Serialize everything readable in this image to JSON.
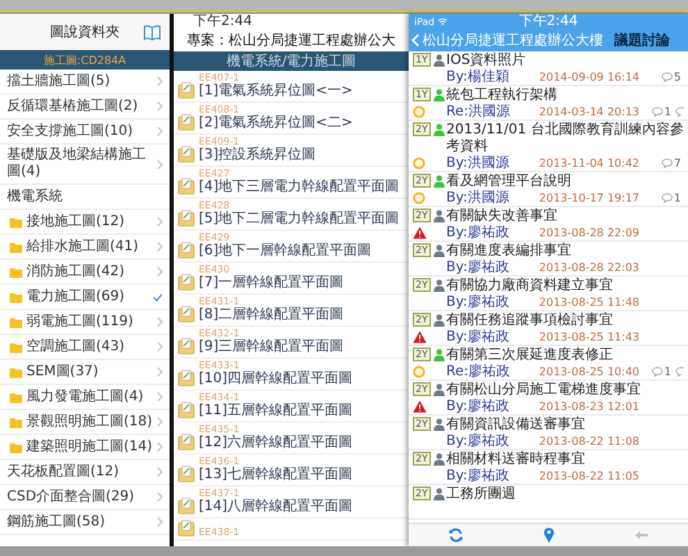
{
  "folder_panel": {
    "title": "圖說資料夾",
    "section": "施工圖:CD284A",
    "items": [
      {
        "label": "擋土牆施工圖(5)",
        "selected": false
      },
      {
        "label": "反循環基樁施工圖(2)",
        "selected": false
      },
      {
        "label": "安全支撐施工圖(10)",
        "selected": false
      },
      {
        "label": "基礎版及地梁結構施工圖(4)",
        "selected": false
      },
      {
        "label": "機電系統",
        "selected": false,
        "children": [
          {
            "label": "接地施工圖(12)",
            "selected": false
          },
          {
            "label": "給排水施工圖(41)",
            "selected": false
          },
          {
            "label": "消防施工圖(42)",
            "selected": false
          },
          {
            "label": "電力施工圖(69)",
            "selected": true
          },
          {
            "label": "弱電施工圖(119)",
            "selected": false
          },
          {
            "label": "空調施工圖(43)",
            "selected": false
          },
          {
            "label": "SEM圖(37)",
            "selected": false
          },
          {
            "label": "風力發電施工圖(4)",
            "selected": false
          },
          {
            "label": "景觀照明施工圖(18)",
            "selected": false
          },
          {
            "label": "建築照明施工圖(14)",
            "selected": false
          }
        ]
      },
      {
        "label": "天花板配置圖(12)",
        "selected": false
      },
      {
        "label": "CSD介面整合圖(29)",
        "selected": false
      },
      {
        "label": "鋼筋施工圖(58)",
        "selected": false
      }
    ]
  },
  "drawing_panel": {
    "status_time": "下午2:44",
    "title": "專案：松山分局捷運工程處辦公大",
    "path": "機電系統/電力施工圖",
    "items": [
      {
        "code": "EE407-1",
        "title": "[1]電氣系統昇位圖<一>"
      },
      {
        "code": "EE408-1",
        "title": "[2]電氣系統昇位圖<二>"
      },
      {
        "code": "EE409-1",
        "title": "[3]控設系統昇位圖"
      },
      {
        "code": "EE427",
        "title": "[4]地下三層電力幹線配置平面圖"
      },
      {
        "code": "EE428",
        "title": "[5]地下二層電力幹線配置平面圖"
      },
      {
        "code": "EE429",
        "title": "[6]地下一層幹線配置平面圖"
      },
      {
        "code": "EE430",
        "title": "[7]一層幹線配置平面圖"
      },
      {
        "code": "EE431-1",
        "title": "[8]二層幹線配置平面圖"
      },
      {
        "code": "EE432-1",
        "title": "[9]三層幹線配置平面圖"
      },
      {
        "code": "EE433-1",
        "title": "[10]四層幹線配置平面圖"
      },
      {
        "code": "EE434-1",
        "title": "[11]五層幹線配置平面圖"
      },
      {
        "code": "EE435-1",
        "title": "[12]六層幹線配置平面圖"
      },
      {
        "code": "EE436-1",
        "title": "[13]七層幹線配置平面圖"
      },
      {
        "code": "EE437-1",
        "title": "[14]八層幹線配置平面圖"
      },
      {
        "code": "EE438-1"
      }
    ]
  },
  "topic_panel": {
    "status_carrier": "iPad",
    "status_time": "下午2:44",
    "back_label": "松山分局捷運工程處辦公大樓",
    "title": "議題討論",
    "topics": [
      {
        "age": "1Y",
        "online": false,
        "kind": "plain",
        "title": "IOS資料照片",
        "author": "By:楊佳穎",
        "date": "2014-09-09 16:14",
        "replies": "5"
      },
      {
        "age": "1Y",
        "online": true,
        "kind": "circle",
        "title": "統包工程執行架構",
        "author": "Re:洪國源",
        "date": "2014-03-14 20:13",
        "replies": "1",
        "second_bubble": true
      },
      {
        "age": "2Y",
        "online": true,
        "kind": "circle",
        "title": "2013/11/01 台北國際教育訓練內容參考資料",
        "author": "By:洪國源",
        "date": "2013-11-04 10:42",
        "replies": "7"
      },
      {
        "age": "2Y",
        "online": true,
        "kind": "circle",
        "title": "看及網管理平台說明",
        "author": "By:洪國源",
        "date": "2013-10-17 19:17",
        "replies": "1"
      },
      {
        "age": "2Y",
        "online": false,
        "kind": "warning",
        "title": "有關缺失改善事宜",
        "author": "By:廖祐政",
        "date": "2013-08-28 22:09"
      },
      {
        "age": "2Y",
        "online": false,
        "kind": "plain",
        "title": "有關進度表編排事宜",
        "author": "By:廖祐政",
        "date": "2013-08-28 22:03"
      },
      {
        "age": "2Y",
        "online": false,
        "kind": "plain",
        "title": "有關協力廠商資料建立事宜",
        "author": "By:廖祐政",
        "date": "2013-08-25 11:48"
      },
      {
        "age": "2Y",
        "online": false,
        "kind": "warning",
        "title": "有關任務追蹤事項檢討事宜",
        "author": "By:廖祐政",
        "date": "2013-08-25 11:43"
      },
      {
        "age": "2Y",
        "online": true,
        "kind": "circle",
        "title": "有關第三次展延進度表修正",
        "author": "Re:廖祐政",
        "date": "2013-08-25 10:40",
        "replies": "1",
        "second_bubble": true
      },
      {
        "age": "2Y",
        "online": false,
        "kind": "warning",
        "title": "有關松山分局施工電梯進度事宜",
        "author": "By:廖祐政",
        "date": "2013-08-23 12:01"
      },
      {
        "age": "2Y",
        "online": false,
        "kind": "plain",
        "title": "有關資訊設備送審事宜",
        "author": "By:廖祐政",
        "date": "2013-08-22 11:08"
      },
      {
        "age": "2Y",
        "online": false,
        "kind": "plain",
        "title": "相關材料送審時程事宜",
        "author": "By:廖祐政",
        "date": "2013-08-22 11:05"
      },
      {
        "age": "2Y",
        "online": false,
        "kind": "plain",
        "title": "工務所團週"
      }
    ]
  }
}
